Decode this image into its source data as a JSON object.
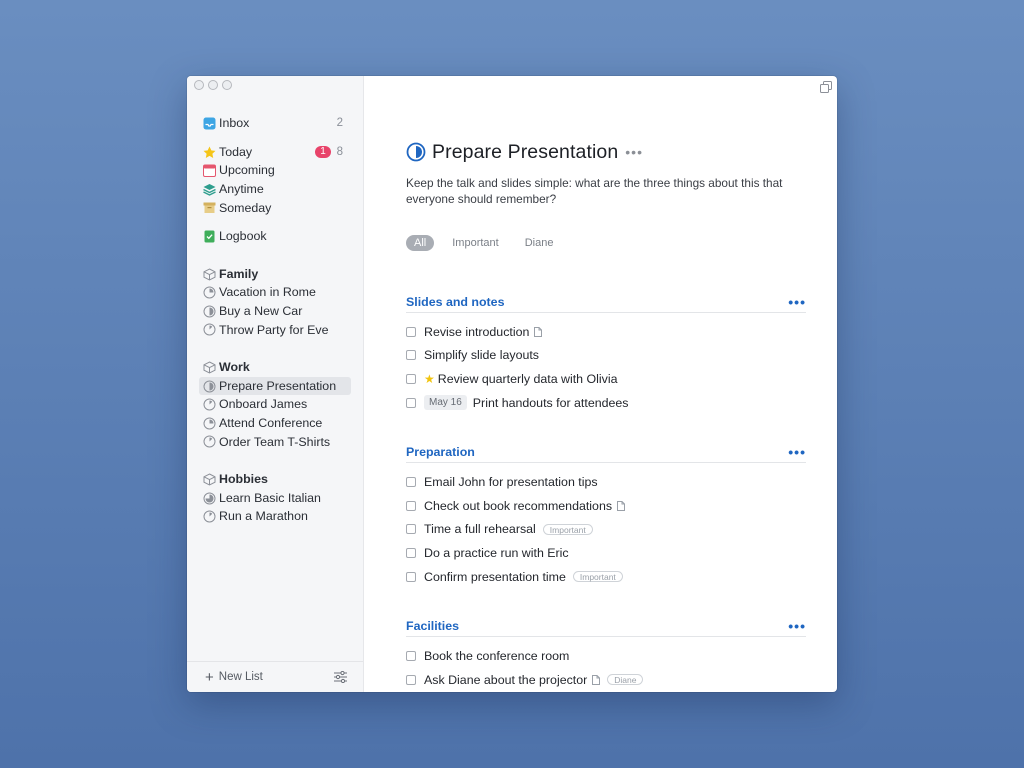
{
  "sidebar": {
    "inbox": {
      "label": "Inbox",
      "count": "2"
    },
    "today": {
      "label": "Today",
      "badge": "1",
      "count": "8"
    },
    "upcoming": {
      "label": "Upcoming"
    },
    "anytime": {
      "label": "Anytime"
    },
    "someday": {
      "label": "Someday"
    },
    "logbook": {
      "label": "Logbook"
    },
    "areas": [
      {
        "name": "Family",
        "projects": [
          "Vacation in Rome",
          "Buy a New Car",
          "Throw Party for Eve"
        ]
      },
      {
        "name": "Work",
        "projects": [
          "Prepare Presentation",
          "Onboard James",
          "Attend Conference",
          "Order Team T-Shirts"
        ]
      },
      {
        "name": "Hobbies",
        "projects": [
          "Learn Basic Italian",
          "Run a Marathon"
        ]
      }
    ],
    "new_list_label": "New List"
  },
  "project": {
    "title": "Prepare Presentation",
    "more": "•••",
    "notes": "Keep the talk and slides simple: what are the three things about this that everyone should remember?",
    "tags": [
      "All",
      "Important",
      "Diane"
    ]
  },
  "sections": [
    {
      "title": "Slides and notes",
      "tasks": [
        {
          "text": "Revise introduction"
        },
        {
          "text": "Simplify slide layouts"
        },
        {
          "text": "Review quarterly data with Olivia"
        },
        {
          "date": "May 16",
          "text": "Print handouts for attendees"
        }
      ]
    },
    {
      "title": "Preparation",
      "tasks": [
        {
          "text": "Email John for presentation tips"
        },
        {
          "text": "Check out book recommendations"
        },
        {
          "text": "Time a full rehearsal",
          "tag": "Important"
        },
        {
          "text": "Do a practice run with Eric"
        },
        {
          "text": "Confirm presentation time",
          "tag": "Important"
        }
      ]
    },
    {
      "title": "Facilities",
      "tasks": [
        {
          "text": "Book the conference room"
        },
        {
          "text": "Ask Diane about the projector",
          "tag": "Diane"
        }
      ]
    }
  ],
  "colors": {
    "accent": "#1f66c1",
    "today_badge": "#e8436a",
    "star": "#f1c40f"
  }
}
